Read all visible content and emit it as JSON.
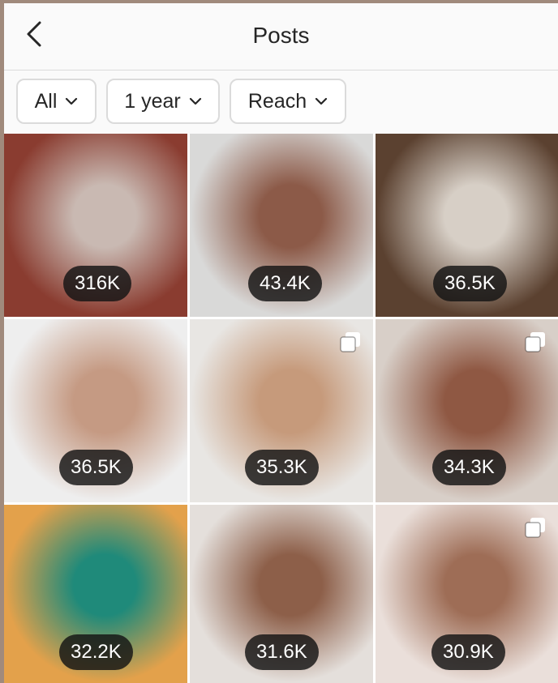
{
  "header": {
    "title": "Posts"
  },
  "filters": [
    {
      "label": "All"
    },
    {
      "label": "1 year"
    },
    {
      "label": "Reach"
    }
  ],
  "posts": [
    {
      "reach": "316K",
      "multi": false,
      "colors": [
        "#8a3c30",
        "#c9b9b2"
      ]
    },
    {
      "reach": "43.4K",
      "multi": false,
      "colors": [
        "#d9d9d8",
        "#8c5a48"
      ]
    },
    {
      "reach": "36.5K",
      "multi": false,
      "colors": [
        "#5b4130",
        "#d7cfc6"
      ]
    },
    {
      "reach": "36.5K",
      "multi": false,
      "colors": [
        "#eeeeee",
        "#c59a83"
      ]
    },
    {
      "reach": "35.3K",
      "multi": true,
      "colors": [
        "#e8e6e3",
        "#c69a7b"
      ]
    },
    {
      "reach": "34.3K",
      "multi": true,
      "colors": [
        "#d8cfc8",
        "#8f5843"
      ]
    },
    {
      "reach": "32.2K",
      "multi": false,
      "colors": [
        "#e3a14b",
        "#1f8a7a"
      ]
    },
    {
      "reach": "31.6K",
      "multi": false,
      "colors": [
        "#e4dfdb",
        "#8d5f49"
      ]
    },
    {
      "reach": "30.9K",
      "multi": true,
      "colors": [
        "#eadfda",
        "#9e6d56"
      ]
    }
  ]
}
